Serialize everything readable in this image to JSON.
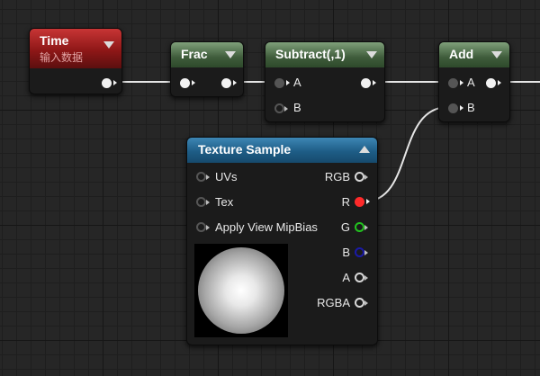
{
  "nodes": {
    "time": {
      "title": "Time",
      "subtitle": "输入数据"
    },
    "frac": {
      "title": "Frac"
    },
    "subtract": {
      "title": "Subtract(,1)",
      "pins": {
        "a": "A",
        "b": "B"
      }
    },
    "add": {
      "title": "Add",
      "pins": {
        "a": "A",
        "b": "B"
      }
    },
    "texture_sample": {
      "title": "Texture Sample",
      "inputs": {
        "uvs": "UVs",
        "tex": "Tex",
        "mipbias": "Apply View MipBias"
      },
      "outputs": {
        "rgb": "RGB",
        "r": "R",
        "g": "G",
        "b": "B",
        "a": "A",
        "rgba": "RGBA"
      },
      "preview_icon": "sphere-preview"
    }
  },
  "colors": {
    "pin_r": "#ff2a2a",
    "pin_g": "#22c21f",
    "pin_b": "#1a1aa8",
    "wire": "#e6e6e6"
  }
}
